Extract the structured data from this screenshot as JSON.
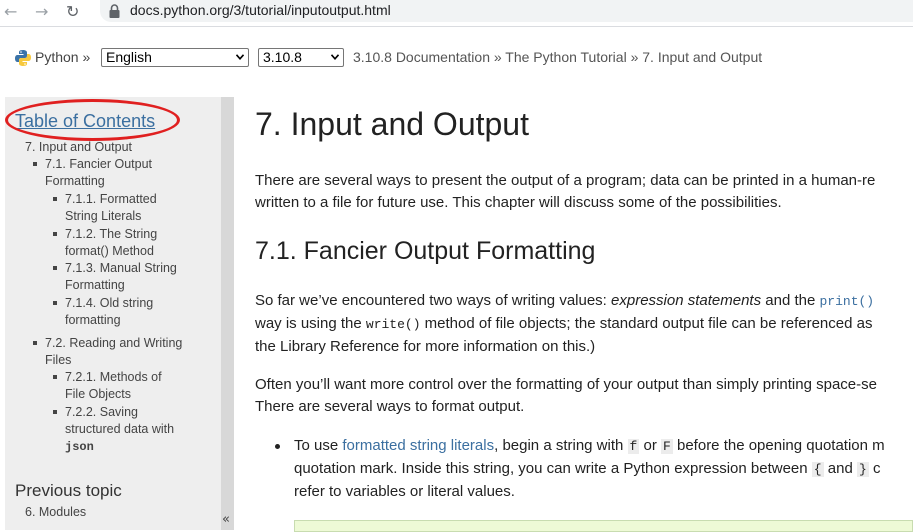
{
  "browser": {
    "url": "docs.python.org/3/tutorial/inputoutput.html",
    "back_icon": "arrow-left-icon",
    "forward_icon": "arrow-right-icon",
    "reload_icon": "reload-icon",
    "lock_icon": "lock-icon"
  },
  "docbar": {
    "python_label": "Python »",
    "language_select": "English",
    "version_select": "3.10.8",
    "breadcrumb": "3.10.8 Documentation » The Python Tutorial » 7. Input and Output"
  },
  "sidebar": {
    "toc_title": "Table of Contents",
    "items": {
      "root": "7. Input and Output",
      "s1_line1": "7.1. Fancier Output",
      "s1_line2": "Formatting",
      "s11_line1": "7.1.1. Formatted",
      "s11_line2": "String Literals",
      "s12_line1": "7.1.2. The String",
      "s12_line2": "format() Method",
      "s13_line1": "7.1.3. Manual String",
      "s13_line2": "Formatting",
      "s14_line1": "7.1.4. Old string",
      "s14_line2": "formatting",
      "s2_line1": "7.2. Reading and Writing",
      "s2_line2": "Files",
      "s21_line1": "7.2.1. Methods of",
      "s21_line2": "File Objects",
      "s22_line1": "7.2.2. Saving",
      "s22_line2": "structured data with",
      "s22_line3": "json"
    },
    "previous_topic_heading": "Previous topic",
    "previous_topic_link": "6. Modules",
    "collapse_label": "«"
  },
  "main": {
    "title": "7. Input and Output",
    "intro_line1": "There are several ways to present the output of a program; data can be printed in a human-re",
    "intro_line2": "written to a file for future use. This chapter will discuss some of the possibilities.",
    "section_title": "7.1. Fancier Output Formatting",
    "p2_a": "So far we’ve encountered two ways of writing values: ",
    "p2_em": "expression statements",
    "p2_b": " and the ",
    "p2_code": "print()",
    "p2_line2_a": "way is using the ",
    "p2_line2_code": "write()",
    "p2_line2_b": " method of file objects; the standard output file can be referenced as",
    "p2_line3": "the Library Reference for more information on this.)",
    "p3_line1": "Often you’ll want more control over the formatting of your output than simply printing space-se",
    "p3_line2": "There are several ways to format output.",
    "li_a": "To use ",
    "li_link": "formatted string literals",
    "li_b": ", begin a string with ",
    "li_f": "f",
    "li_or": " or ",
    "li_F": "F",
    "li_c": " before the opening quotation m",
    "li_line2_a": "quotation mark. Inside this string, you can write a Python expression between ",
    "li_brace_open": "{",
    "li_and": " and ",
    "li_brace_close": "}",
    "li_line2_b": " c",
    "li_line3": "refer to variables or literal values."
  }
}
